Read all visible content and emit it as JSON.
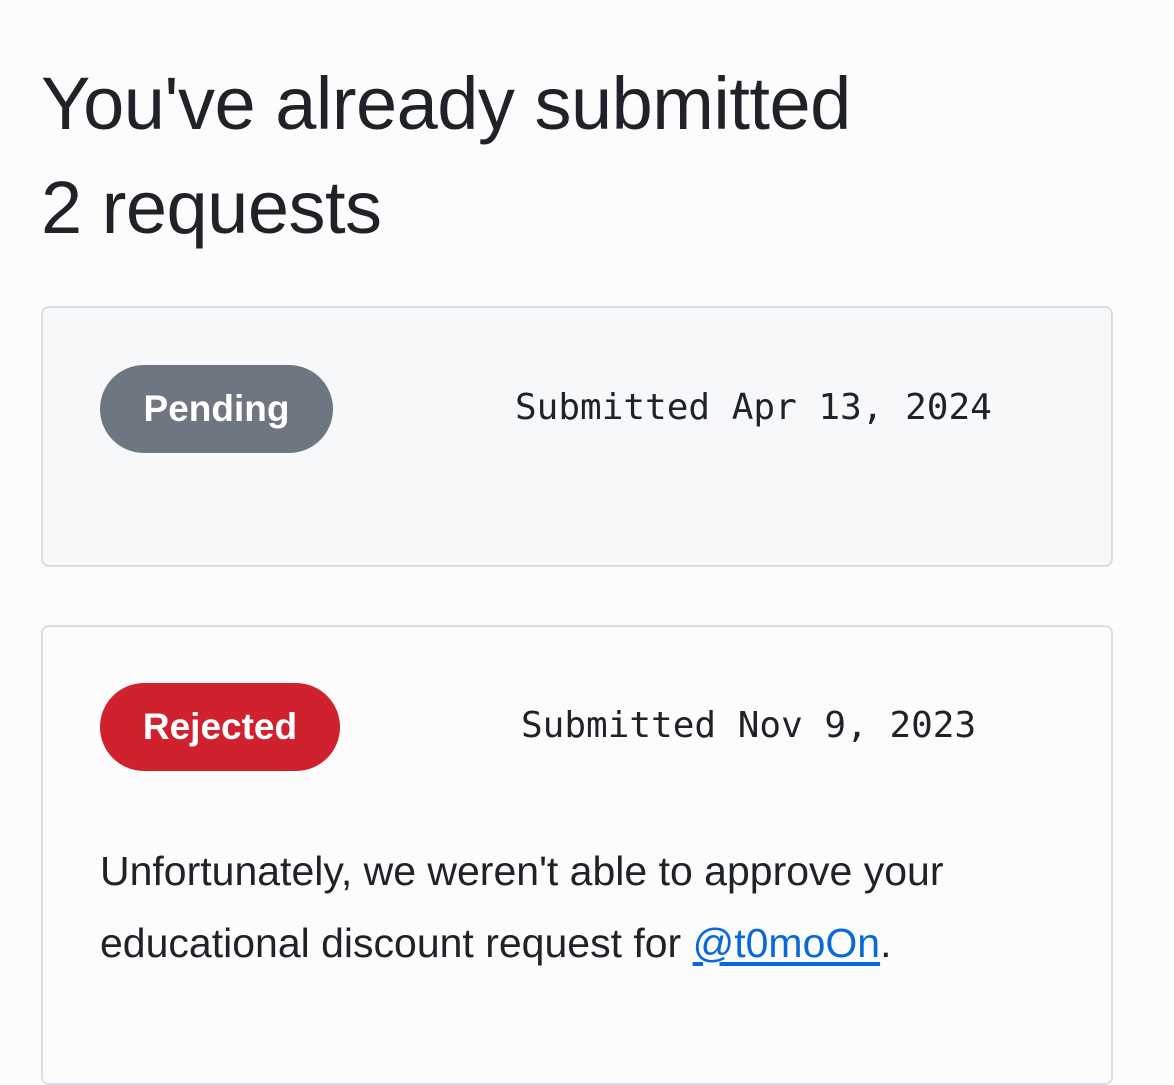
{
  "page": {
    "title_line1": "You've already submitted",
    "title_line2": "2 requests"
  },
  "requests": [
    {
      "status": "Pending",
      "status_color": "#6e7781",
      "submitted_text": "Submitted Apr 13, 2024"
    },
    {
      "status": "Rejected",
      "status_color": "#cf222e",
      "submitted_text": "Submitted Nov 9, 2023",
      "message_before": "Unfortunately, we weren't able to approve your educational discount request for ",
      "username": "@t0moOn",
      "message_after": "."
    }
  ],
  "colors": {
    "link": "#0969da",
    "text": "#1f2328"
  }
}
